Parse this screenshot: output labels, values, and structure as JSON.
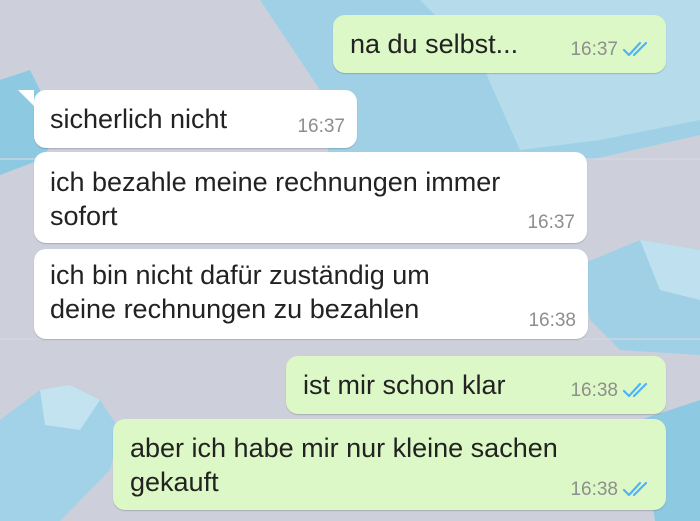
{
  "colors": {
    "incoming_bubble": "#ffffff",
    "outgoing_bubble": "#dcf8c6",
    "read_ticks": "#4fb3f7",
    "timestamp": "#8e8e8e",
    "wallpaper": "#cdd1dc",
    "iceberg": "#8fcbe5"
  },
  "messages": [
    {
      "direction": "outgoing",
      "lines": [
        "na du selbst..."
      ],
      "time": "16:37",
      "status_icon": "double-check-read-icon"
    },
    {
      "direction": "incoming",
      "lines": [
        "sicherlich nicht"
      ],
      "time": "16:37"
    },
    {
      "direction": "incoming",
      "lines": [
        "ich bezahle meine rechnungen immer",
        "sofort"
      ],
      "time": "16:37"
    },
    {
      "direction": "incoming",
      "lines": [
        "ich bin nicht dafür zuständig um",
        "deine rechnungen zu bezahlen"
      ],
      "time": "16:38"
    },
    {
      "direction": "outgoing",
      "lines": [
        "ist mir schon klar"
      ],
      "time": "16:38",
      "status_icon": "double-check-read-icon"
    },
    {
      "direction": "outgoing",
      "lines": [
        "aber ich habe mir nur kleine sachen",
        "gekauft"
      ],
      "time": "16:38",
      "status_icon": "double-check-read-icon"
    }
  ]
}
